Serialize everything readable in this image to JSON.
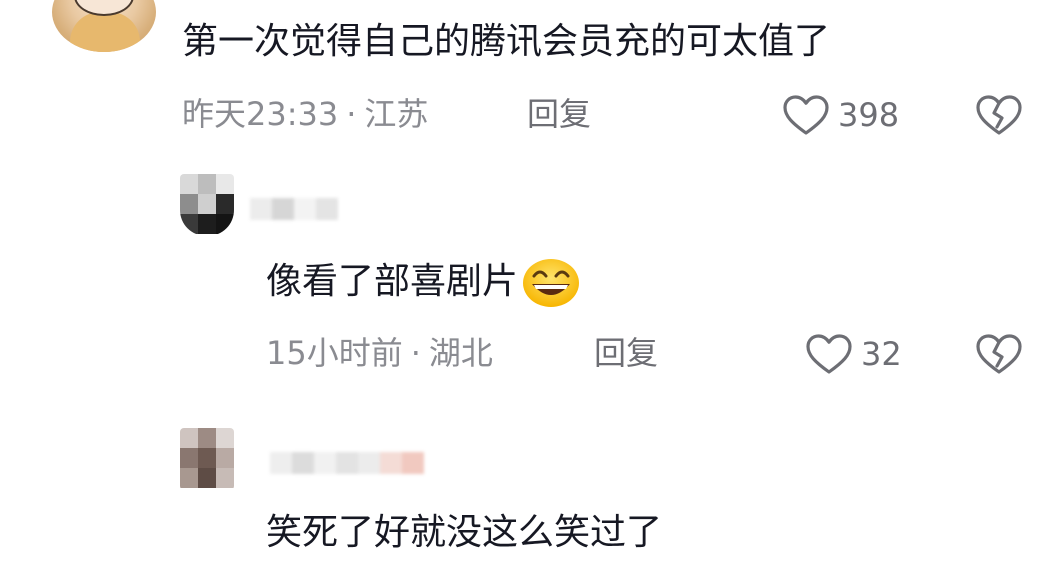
{
  "comments": [
    {
      "text": "第一次觉得自己的腾讯会员充的可太值了",
      "time": "昨天23:33",
      "separator": "·",
      "location": "江苏",
      "reply_label": "回复",
      "likes": "398"
    },
    {
      "text": "像看了部喜剧片",
      "emoji": "grinning-squinting-face-emoji",
      "time": "15小时前",
      "separator": "·",
      "location": "湖北",
      "reply_label": "回复",
      "likes": "32"
    },
    {
      "text": "笑死了好就没这么笑过了"
    }
  ],
  "icons": {
    "like": "heart-outline-icon",
    "dislike": "broken-heart-icon"
  },
  "colors": {
    "text_primary": "#161823",
    "text_secondary": "#8a8b91",
    "icon": "#6d6e74"
  }
}
